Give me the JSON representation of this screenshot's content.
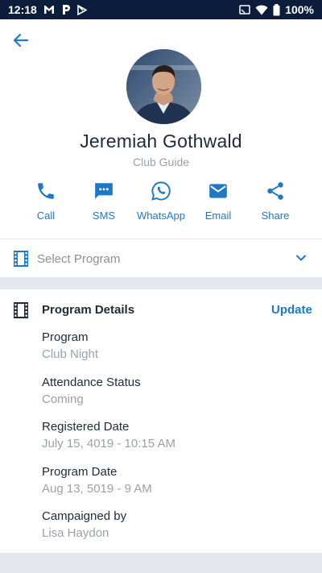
{
  "status_bar": {
    "time": "12:18",
    "battery": "100%"
  },
  "profile": {
    "name": "Jeremiah Gothwald",
    "role": "Club Guide"
  },
  "actions": [
    {
      "id": "call",
      "label": "Call",
      "icon": "phone-icon"
    },
    {
      "id": "sms",
      "label": "SMS",
      "icon": "sms-icon"
    },
    {
      "id": "whatsapp",
      "label": "WhatsApp",
      "icon": "whatsapp-icon"
    },
    {
      "id": "email",
      "label": "Email",
      "icon": "email-icon"
    },
    {
      "id": "share",
      "label": "Share",
      "icon": "share-icon"
    }
  ],
  "program_select": {
    "placeholder": "Select Program"
  },
  "program_details": {
    "title": "Program Details",
    "update_label": "Update",
    "fields": [
      {
        "label": "Program",
        "value": "Club Night"
      },
      {
        "label": "Attendance Status",
        "value": "Coming"
      },
      {
        "label": "Registered Date",
        "value": "July 15, 4019 - 10:15 AM"
      },
      {
        "label": "Program Date",
        "value": "Aug 13, 5019 - 9 AM"
      },
      {
        "label": "Campaigned by",
        "value": "Lisa Haydon"
      }
    ]
  },
  "colors": {
    "accent": "#1e78c8",
    "status_bar": "#0b1d3a",
    "muted_text": "#9aa1aa",
    "band": "#e4e7eb"
  }
}
